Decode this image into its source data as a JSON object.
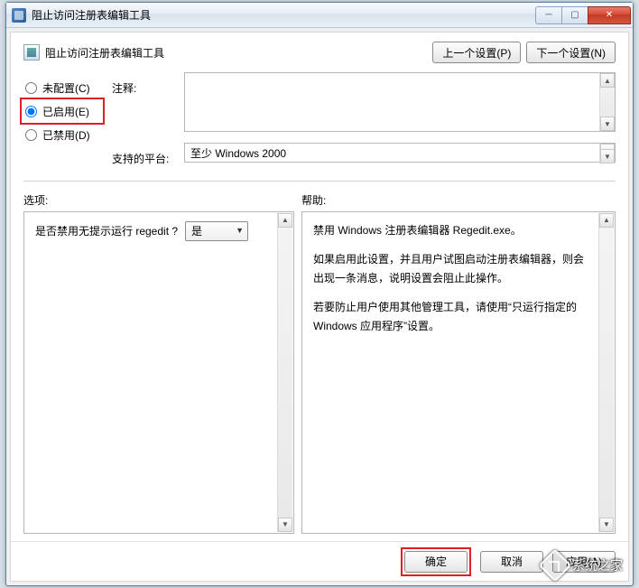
{
  "window": {
    "title": "阻止访问注册表编辑工具"
  },
  "titlebar_controls": {
    "minimize": "─",
    "maximize": "▢",
    "close": "✕"
  },
  "header": {
    "title": "阻止访问注册表编辑工具",
    "prev_button": "上一个设置(P)",
    "next_button": "下一个设置(N)"
  },
  "state_options": {
    "not_configured": "未配置(C)",
    "enabled": "已启用(E)",
    "disabled": "已禁用(D)",
    "selected": "enabled"
  },
  "labels": {
    "comment": "注释:",
    "supported_on": "支持的平台:"
  },
  "comment_value": "",
  "supported_on_value": "至少 Windows 2000",
  "section_labels": {
    "options": "选项:",
    "help": "帮助:"
  },
  "options_panel": {
    "question": "是否禁用无提示运行 regedit ?",
    "select_value": "是"
  },
  "help_panel": {
    "p1": "禁用 Windows 注册表编辑器 Regedit.exe。",
    "p2": "如果启用此设置，并且用户试图启动注册表编辑器，则会出现一条消息，说明设置会阻止此操作。",
    "p3": "若要防止用户使用其他管理工具，请使用“只运行指定的 Windows 应用程序”设置。"
  },
  "footer": {
    "ok": "确定",
    "cancel": "取消",
    "apply": "应用(A)"
  },
  "watermark": "系统之家"
}
